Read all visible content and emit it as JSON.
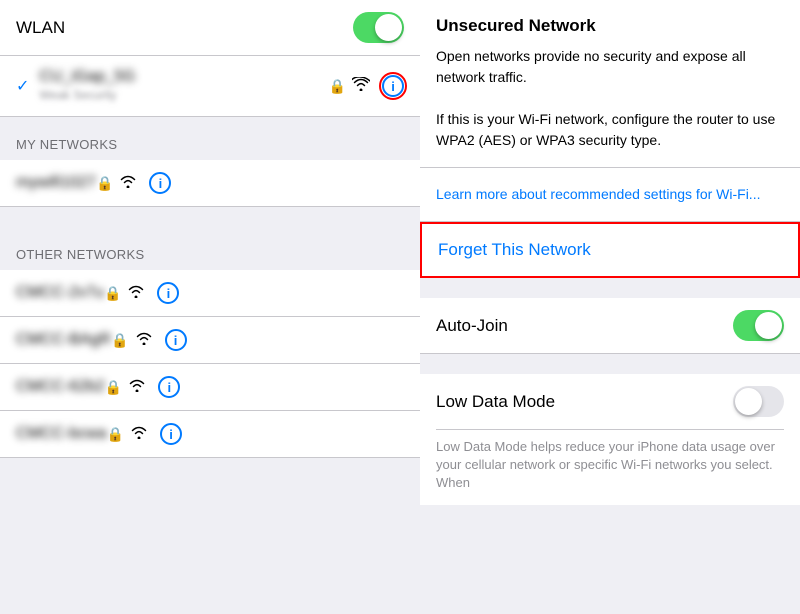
{
  "left": {
    "wlan_label": "WLAN",
    "wlan_enabled": true,
    "connected_network": {
      "name": "CU_iGap_5G",
      "security": "Weak Security",
      "blurred": true
    },
    "my_networks_header": "MY NETWORKS",
    "my_networks": [
      {
        "id": "mywifi1027",
        "name": "mywifi1027",
        "blurred": true
      }
    ],
    "other_networks_header": "OTHER NETWORKS",
    "other_networks": [
      {
        "id": "cmcc-2v7u",
        "name": "CMCC-2v7u",
        "blurred": true
      },
      {
        "id": "cmcc-bagr",
        "name": "CMCC-BAgR",
        "blurred": true
      },
      {
        "id": "cmcc-62b2",
        "name": "CMCC-62b2",
        "blurred": true
      },
      {
        "id": "cmcc-bcwa",
        "name": "CMCC-bcwa",
        "blurred": true
      }
    ]
  },
  "right": {
    "title": "Unsecured Network",
    "description_line1": "Open networks provide no security and expose all network traffic.",
    "description_line2": "If this is your Wi-Fi network, configure the router to use WPA2 (AES) or WPA3 security type.",
    "learn_more_text": "Learn more about recommended settings for Wi-Fi...",
    "forget_label": "Forget This Network",
    "auto_join_label": "Auto-Join",
    "auto_join_enabled": true,
    "low_data_mode_label": "Low Data Mode",
    "low_data_mode_enabled": false,
    "low_data_desc": "Low Data Mode helps reduce your iPhone data usage over your cellular network or specific Wi-Fi networks you select. When"
  }
}
